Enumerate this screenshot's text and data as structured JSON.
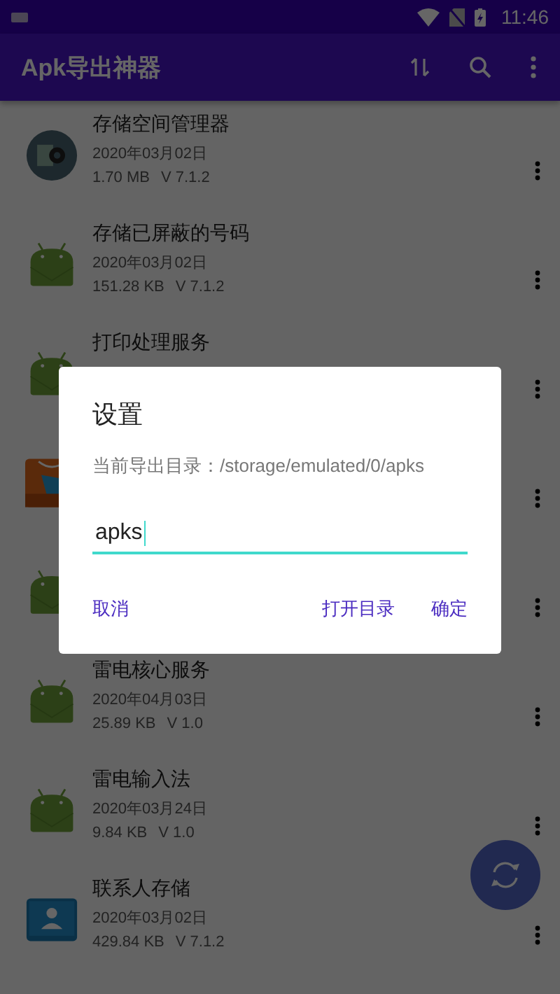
{
  "status_bar": {
    "time": "11:46"
  },
  "app_bar": {
    "title": "Apk导出神器"
  },
  "apps": [
    {
      "kind": "storage",
      "title": "存储空间管理器",
      "date": "2020年03月02日",
      "size": "1.70 MB",
      "version": "V 7.1.2"
    },
    {
      "kind": "android",
      "title": "存储已屏蔽的号码",
      "date": "2020年03月02日",
      "size": "151.28 KB",
      "version": "V 7.1.2"
    },
    {
      "kind": "android",
      "title": "打印处理服务"
    },
    {
      "kind": "store"
    },
    {
      "kind": "android"
    },
    {
      "kind": "android",
      "title": "雷电核心服务",
      "date": "2020年04月03日",
      "size": "25.89 KB",
      "version": "V 1.0"
    },
    {
      "kind": "android",
      "title": "雷电输入法",
      "date": "2020年03月24日",
      "size": "9.84 KB",
      "version": "V 1.0"
    },
    {
      "kind": "contacts",
      "title": "联系人存储",
      "date": "2020年03月02日",
      "size": "429.84 KB",
      "version": "V 7.1.2"
    }
  ],
  "dialog": {
    "title": "设置",
    "message": "当前导出目录：/storage/emulated/0/apks",
    "input": {
      "value": "apks"
    },
    "buttons": [
      {
        "label": "取消",
        "kind": "left"
      },
      {
        "label": "打开目录",
        "kind": "right"
      },
      {
        "label": "确定",
        "kind": "right"
      }
    ]
  }
}
